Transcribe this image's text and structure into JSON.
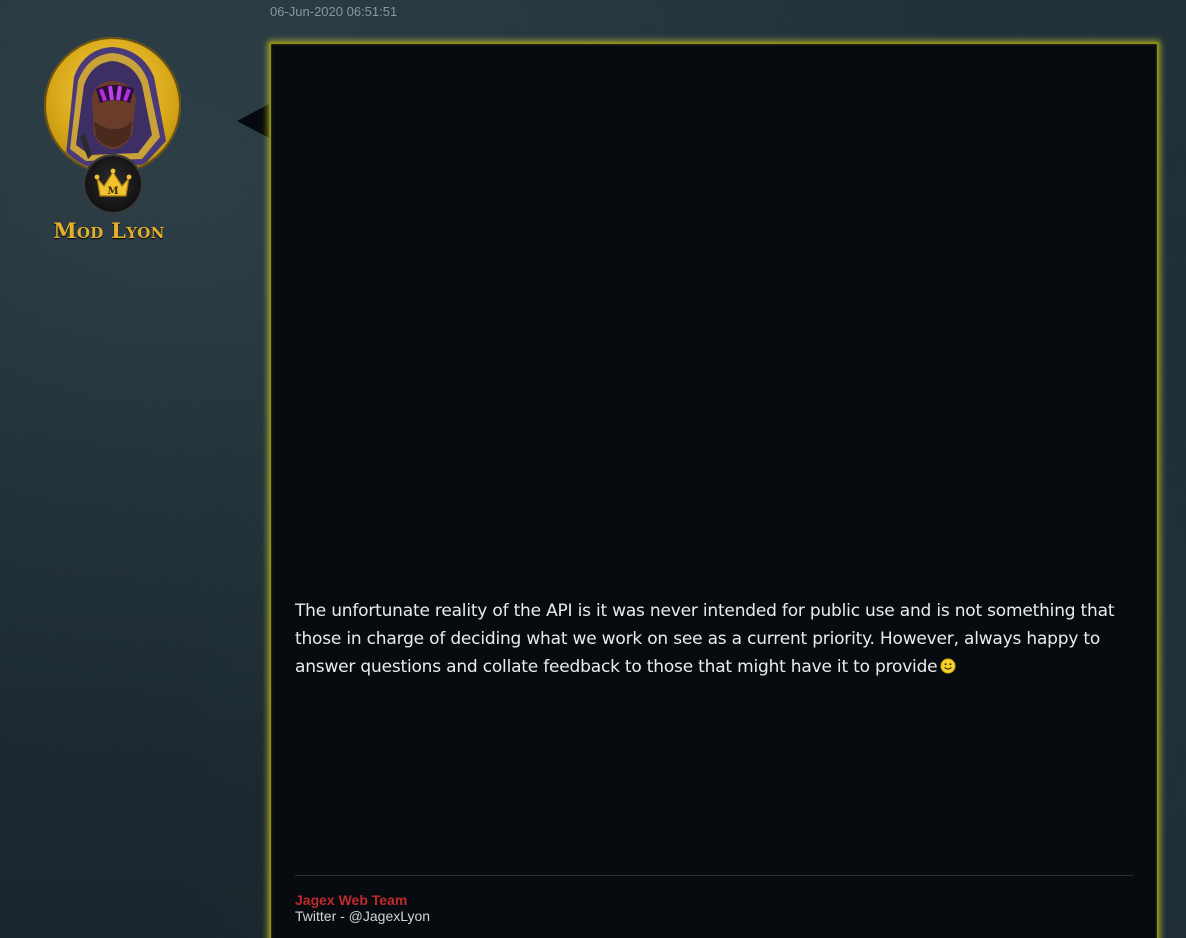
{
  "post": {
    "timestamp": "06-Jun-2020 06:51:51",
    "body": "The unfortunate reality of the API is it was never intended for public use and is not something that those in charge of deciding what we work on see as a current priority. However, always happy to answer questions and collate feedback to those that might have it to provide",
    "emoji": "smiley-icon"
  },
  "author": {
    "name": "Mod Lyon",
    "badge_letter": "M",
    "avatar_icon": "hooded-avatar-icon",
    "badge_icon": "crown-icon"
  },
  "signature": {
    "team": "Jagex Web Team",
    "twitter": "Twitter - @JagexLyon"
  },
  "colors": {
    "accent_gold": "#e3b02c",
    "border_glow": "#d8d820",
    "team_red": "#c02a2a",
    "post_bg": "#070b10"
  }
}
